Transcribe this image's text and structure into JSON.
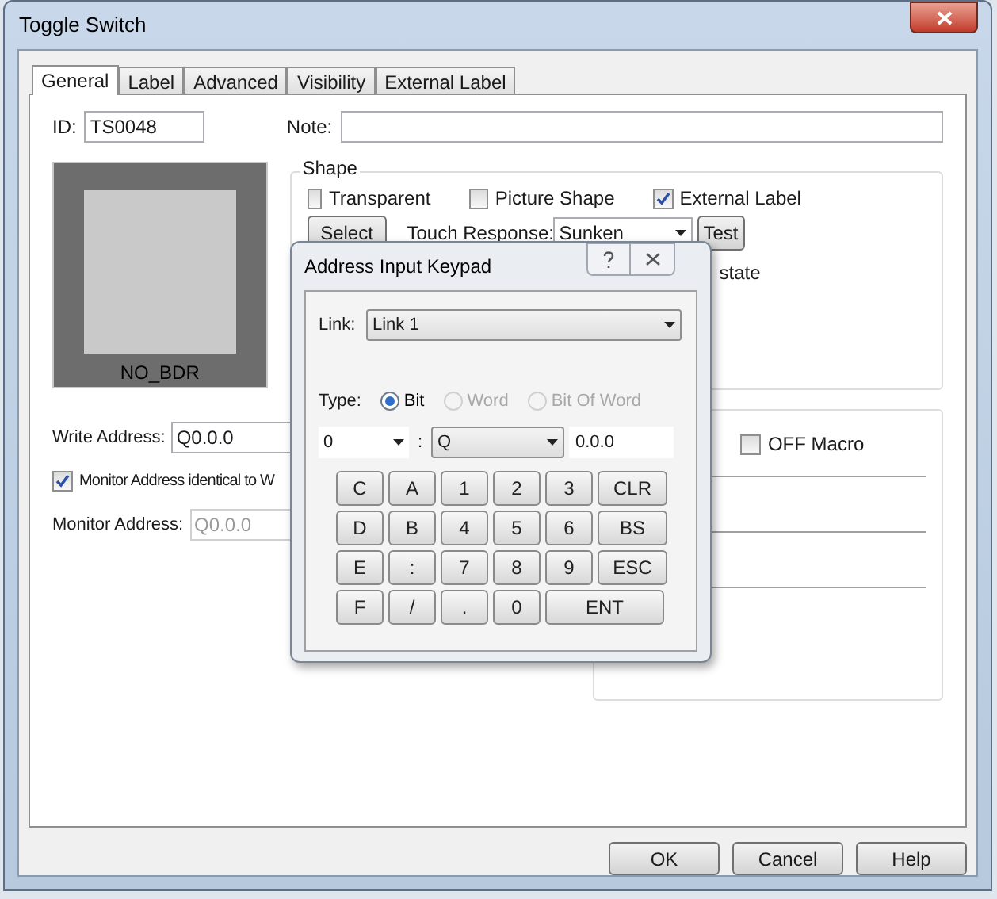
{
  "window": {
    "title": "Toggle Switch"
  },
  "tabs": [
    {
      "label": "General",
      "selected": true
    },
    {
      "label": "Label",
      "selected": false
    },
    {
      "label": "Advanced",
      "selected": false
    },
    {
      "label": "Visibility",
      "selected": false
    },
    {
      "label": "External Label",
      "selected": false
    }
  ],
  "general": {
    "id_label": "ID:",
    "id_value": "TS0048",
    "note_label": "Note:",
    "preview_label": "NO_BDR",
    "shape": {
      "title": "Shape",
      "options": [
        {
          "label": "Transparent",
          "checked": false
        },
        {
          "label": "Picture Shape",
          "checked": false
        },
        {
          "label": "External Label",
          "checked": true
        }
      ],
      "select_button": "Select",
      "touch_response_label": "Touch Response:",
      "touch_response_value": "Sunken",
      "test_button": "Test",
      "hint": "state"
    },
    "write_address_label": "Write Address:",
    "write_address_value": "Q0.0.0",
    "monitor_identical": {
      "label": "Monitor Address identical to W",
      "checked": true
    },
    "monitor_address_label": "Monitor Address:",
    "monitor_address_value": "Q0.0.0",
    "off_macro": {
      "label": "OFF Macro",
      "checked": false
    }
  },
  "keypad": {
    "title": "Address Input Keypad",
    "link_label": "Link:",
    "link_value": "Link 1",
    "type_label": "Type:",
    "types": [
      {
        "label": "Bit",
        "selected": true,
        "disabled": false
      },
      {
        "label": "Word",
        "selected": false,
        "disabled": true
      },
      {
        "label": "Bit Of Word",
        "selected": false,
        "disabled": true
      }
    ],
    "station": "0",
    "separator": ":",
    "device": "Q",
    "address": "0.0.0",
    "keys": [
      [
        {
          "label": "C",
          "kind": "char"
        },
        {
          "label": "A",
          "kind": "char"
        },
        {
          "label": "1",
          "kind": "char"
        },
        {
          "label": "2",
          "kind": "char"
        },
        {
          "label": "3",
          "kind": "char"
        },
        {
          "label": "CLR",
          "kind": "command"
        }
      ],
      [
        {
          "label": "D",
          "kind": "char"
        },
        {
          "label": "B",
          "kind": "char"
        },
        {
          "label": "4",
          "kind": "char"
        },
        {
          "label": "5",
          "kind": "char"
        },
        {
          "label": "6",
          "kind": "char"
        },
        {
          "label": "BS",
          "kind": "command"
        }
      ],
      [
        {
          "label": "E",
          "kind": "char"
        },
        {
          "label": ":",
          "kind": "char"
        },
        {
          "label": "7",
          "kind": "char"
        },
        {
          "label": "8",
          "kind": "char"
        },
        {
          "label": "9",
          "kind": "char"
        },
        {
          "label": "ESC",
          "kind": "command"
        }
      ],
      [
        {
          "label": "F",
          "kind": "char"
        },
        {
          "label": "/",
          "kind": "char"
        },
        {
          "label": ".",
          "kind": "char"
        },
        {
          "label": "0",
          "kind": "char"
        },
        {
          "label": "ENT",
          "kind": "enter"
        }
      ]
    ]
  },
  "buttons": [
    "OK",
    "Cancel",
    "Help"
  ]
}
